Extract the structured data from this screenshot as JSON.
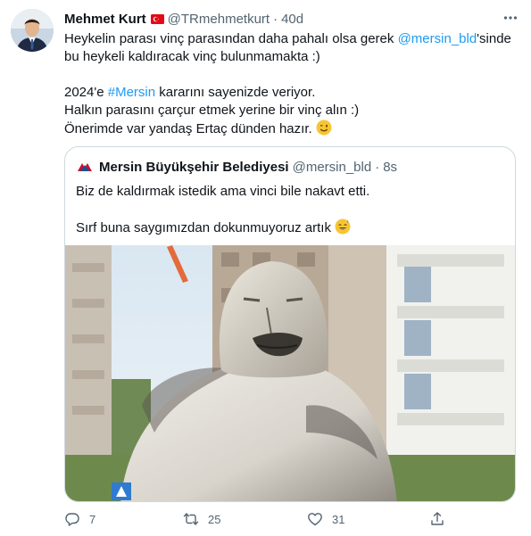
{
  "tweet": {
    "author_name": "Mehmet Kurt",
    "author_handle": "@TRmehmetkurt",
    "separator": "·",
    "time_ago": "40d",
    "more_icon": "more-horizontal-icon",
    "lines": {
      "l1_pre": "Heykelin parası vinç parasından daha pahalı olsa gerek ",
      "l1_mention": "@mersin_bld",
      "l1_post": "'sinde",
      "l2": "bu heykeli kaldıracak vinç bulunmamakta :)",
      "l3_pre": "2024'e ",
      "l3_hashtag": "#Mersin",
      "l3_post": " kararını sayenizde veriyor.",
      "l4": "Halkın parasını çarçur etmek yerine bir vinç alın :)",
      "l5": "Önerimde var yandaş Ertaç dünden hazır."
    }
  },
  "quote": {
    "author_name": "Mersin Büyükşehir Belediyesi",
    "author_handle": "@mersin_bld",
    "separator": "·",
    "time_ago": "8s",
    "line1": "Biz de kaldırmak istedik ama vinci bile nakavt etti.",
    "line2": "Sırf buna saygımızdan dokunmuyoruz artık"
  },
  "actions": {
    "reply_count": "7",
    "retweet_count": "25",
    "like_count": "31"
  },
  "colors": {
    "link": "#1d9bf0",
    "muted": "#536471",
    "border": "#cfd9de"
  }
}
